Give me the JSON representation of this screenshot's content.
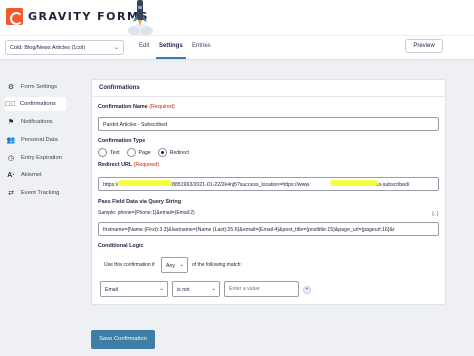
{
  "brand": {
    "name": "GRAVITY FORMS"
  },
  "header": {
    "form_select": "Cold: Blog/News Articles (1col)",
    "tabs": [
      "Edit",
      "Settings",
      "Entries"
    ],
    "active_tab": "Settings",
    "preview_label": "Preview"
  },
  "sidebar": {
    "items": [
      {
        "label": "Form Settings",
        "icon": "gear-icon"
      },
      {
        "label": "Confirmations",
        "icon": "check-circle-icon",
        "active": true
      },
      {
        "label": "Notifications",
        "icon": "flag-icon"
      },
      {
        "label": "Personal Data",
        "icon": "users-icon"
      },
      {
        "label": "Entry Expiration",
        "icon": "clock-icon"
      },
      {
        "label": "Akismet",
        "icon": "akismet-icon"
      },
      {
        "label": "Event Tracking",
        "icon": "event-tracking-icon"
      }
    ]
  },
  "panel": {
    "title": "Confirmations",
    "name_label": "Confirmation Name",
    "required_text": "(Required)",
    "name_value": "Pardot Articles - Subscribed",
    "type_label": "Confirmation Type",
    "type_options": [
      "Text",
      "Page",
      "Redirect"
    ],
    "type_selected": "Redirect",
    "url_label": "Redirect URL",
    "url_value_start": "https://",
    "url_value_mid": "/8851963/2021-01-22/2k4nj5?success_location=https://www.",
    "url_value_end": "success-subscribed/",
    "query_label": "Pass Field Data via Query String",
    "query_sample": "Sample: phone={Phone:1}&email={Email:2}",
    "query_value": "firstname={Name (First):3.3}&lastname={Name (Last):25.6}&email={Email:4}&post_title={posttitle:15}&page_url={pageurl:16}&r",
    "merge_tag_button": "{..}",
    "logic_label": "Conditional Logic",
    "logic_prefix": "Use this confirmation if",
    "logic_match": "Any",
    "logic_suffix": "of the following match:",
    "rule_field": "Email",
    "rule_operator": "is not",
    "rule_value_placeholder": "Enter a value",
    "add_rule": "+"
  },
  "save_label": "Save Confirmation",
  "colors": {
    "accent": "#3e7da6",
    "brand": "#f15a2b",
    "required": "#c02b0a",
    "highlight": "#f6ff3e"
  }
}
